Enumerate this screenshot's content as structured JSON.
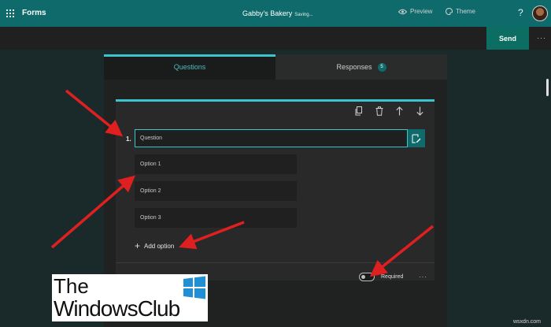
{
  "topbar": {
    "app_name": "Forms",
    "doc_title": "Gabby's Bakery",
    "saving": "Saving...",
    "help": "?"
  },
  "commands": {
    "preview": "Preview",
    "theme": "Theme",
    "send": "Send",
    "more": "···"
  },
  "tabs": {
    "questions": "Questions",
    "responses": "Responses",
    "responses_count": "5"
  },
  "question": {
    "number": "1.",
    "placeholder": "Question",
    "options": [
      "Option 1",
      "Option 2",
      "Option 3"
    ],
    "add_option": "Add option",
    "required_label": "Required",
    "required_on": false,
    "more": "···"
  },
  "logo": {
    "line1": "The",
    "line2": "WindowsClub"
  },
  "watermark": "wsxdn.com",
  "colors": {
    "brand": "#0f6b6b",
    "accent": "#3cc3cc",
    "annotation": "#e02020"
  }
}
